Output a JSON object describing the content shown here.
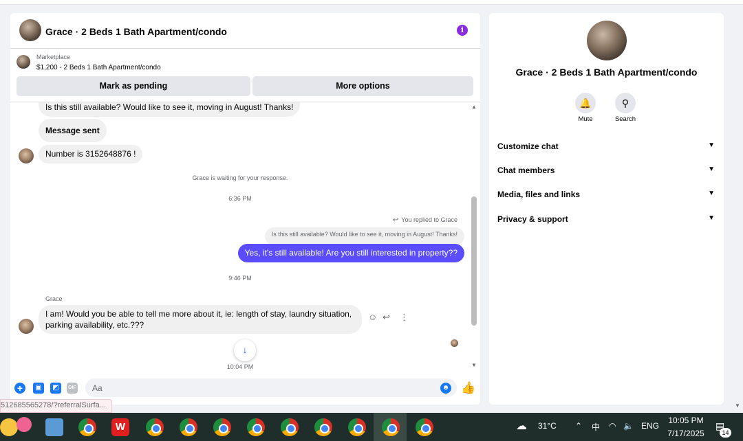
{
  "chat": {
    "header_title": "Grace · 2 Beds 1 Bath Apartment/condo",
    "info_icon": "info-icon",
    "marketplace_label": "Marketplace",
    "listing_price_title": "$1,200 - 2 Beds 1 Bath Apartment/condo",
    "buttons": {
      "mark_pending": "Mark as pending",
      "more_options": "More options"
    },
    "messages": {
      "m1": "Is this still available? Would like to see it, moving in August! Thanks!",
      "m2": "Message sent",
      "m3": "Number is 3152648876 !",
      "waiting": "Grace is waiting for your response.",
      "time1": "6:36 PM",
      "replied_label": "You replied to Grace",
      "quoted": "Is this still available? Would like to see it, moving in August! Thanks!",
      "outgoing": "Yes, it's still available! Are you still interested in property??",
      "time2": "9:46 PM",
      "sender": "Grace",
      "m4": "I am! Would you be able to tell me more about it, ie: length of stay, laundry situation, parking availability, etc.???",
      "time3": "10:04 PM"
    },
    "composer": {
      "placeholder": "Aa"
    }
  },
  "status_url": "512685565278/?referralSurfa...",
  "side": {
    "title": "Grace · 2 Beds 1 Bath Apartment/condo",
    "mute_label": "Mute",
    "search_label": "Search",
    "sections": [
      "Customize chat",
      "Chat members",
      "Media, files and links",
      "Privacy & support"
    ]
  },
  "taskbar": {
    "temperature": "31°C",
    "language": "ENG",
    "time": "10:05 PM",
    "date": "7/17/2025",
    "notification_count": "14"
  },
  "colors": {
    "accent": "#1877f2",
    "outgoing_bubble": "#5b4dff",
    "info": "#8a2be2"
  }
}
